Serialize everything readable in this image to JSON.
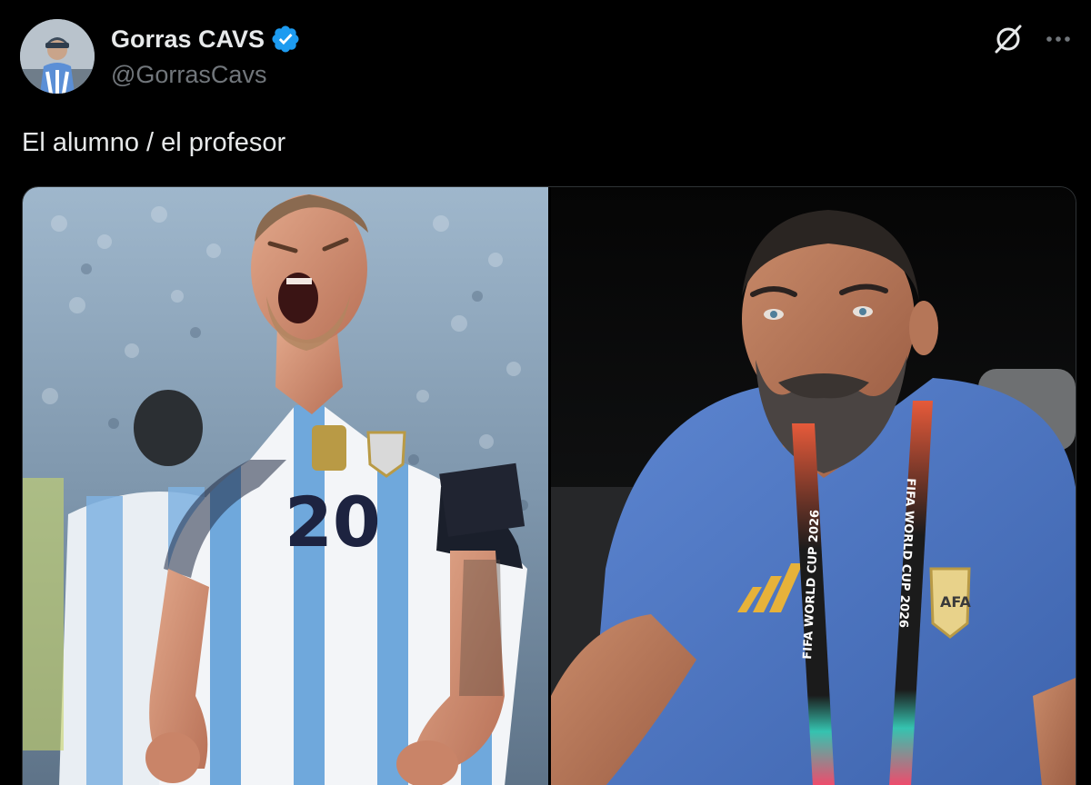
{
  "tweet": {
    "author": {
      "display_name": "Gorras CAVS",
      "handle": "@GorrasCavs",
      "verified": true,
      "avatar_icon": "profile-photo"
    },
    "text": "El alumno / el profesor",
    "actions": {
      "grok_icon": "grok-icon",
      "more_icon": "more-options-icon"
    },
    "media": [
      {
        "kind": "photo",
        "subject": "player-celebrating",
        "shirt_number": "20"
      },
      {
        "kind": "photo",
        "subject": "coach-on-bench",
        "lanyard_text": "FIFA WORLD CUP 2026"
      }
    ]
  },
  "colors": {
    "background": "#000000",
    "text_primary": "#e7e9ea",
    "text_secondary": "#71767b",
    "verified_blue": "#1d9bf0",
    "border": "#2f3336"
  }
}
